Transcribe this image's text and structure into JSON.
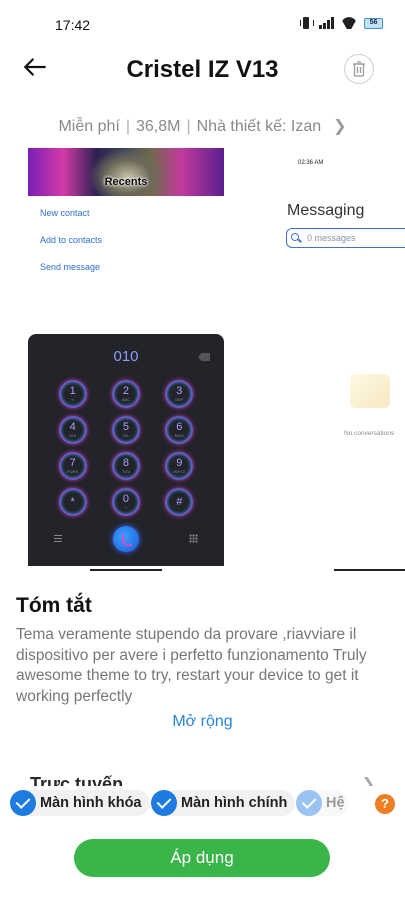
{
  "status": {
    "time": "17:42",
    "battery": "56"
  },
  "header": {
    "title": "Cristel IZ V13"
  },
  "info": {
    "price": "Miễn phí",
    "size": "36,8M",
    "designer": "Nhà thiết kế: Izan"
  },
  "preview1": {
    "hero_label": "Recents",
    "actions": [
      "New contact",
      "Add to contacts",
      "Send message"
    ],
    "dial_number": "010",
    "keys": [
      {
        "d": "1",
        "l": "∞"
      },
      {
        "d": "2",
        "l": "ABC"
      },
      {
        "d": "3",
        "l": "DEF"
      },
      {
        "d": "4",
        "l": "GHI"
      },
      {
        "d": "5",
        "l": "JKL"
      },
      {
        "d": "6",
        "l": "MNO"
      },
      {
        "d": "7",
        "l": "PQRS"
      },
      {
        "d": "8",
        "l": "TUV"
      },
      {
        "d": "9",
        "l": "WXYZ"
      },
      {
        "d": "*",
        "l": ""
      },
      {
        "d": "0",
        "l": "+"
      },
      {
        "d": "#",
        "l": ""
      }
    ]
  },
  "preview2": {
    "time": "02:36 AM",
    "title": "Messaging",
    "search_placeholder": "0 messages",
    "empty_text": "No conversations"
  },
  "summary": {
    "title": "Tóm tắt",
    "body": "Tema veramente stupendo da provare ,riavviare il dispositivo per avere i perfetto funzionamento Truly awesome theme to try, restart your device to get it working perfectly",
    "expand": "Mở rộng"
  },
  "next_section": {
    "title": "Trực tuyến"
  },
  "targets": {
    "items": [
      "Màn hình khóa",
      "Màn hình chính",
      "Hệ"
    ],
    "help": "?"
  },
  "apply": {
    "label": "Áp dụng"
  },
  "colors": {
    "accent": "#1e7be0",
    "apply": "#39b54a",
    "link": "#2a86d8",
    "help": "#ef7d22"
  }
}
